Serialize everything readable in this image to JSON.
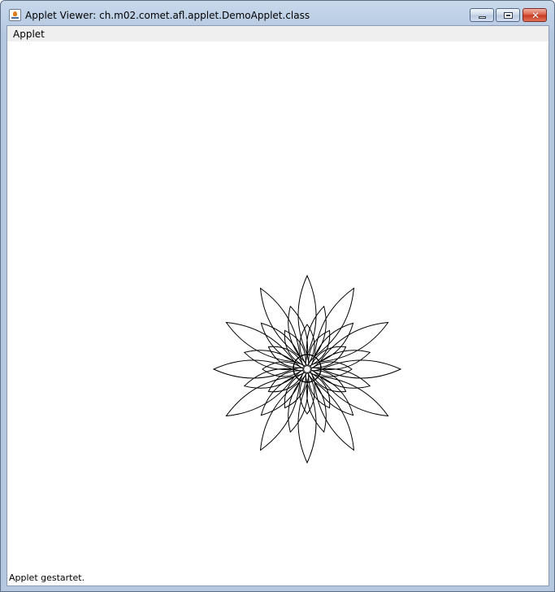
{
  "window": {
    "title": "Applet Viewer: ch.m02.comet.afl.applet.DemoApplet.class",
    "icon": "java-applet-icon",
    "controls": {
      "minimize": "minimize-icon",
      "maximize": "maximize-icon",
      "close": "✕"
    }
  },
  "menubar": {
    "items": [
      "Applet"
    ]
  },
  "status": {
    "text": "Applet gestartet."
  },
  "drawing": {
    "shape": "rosette",
    "stroke_color": "#000000",
    "background": "#ffffff"
  }
}
